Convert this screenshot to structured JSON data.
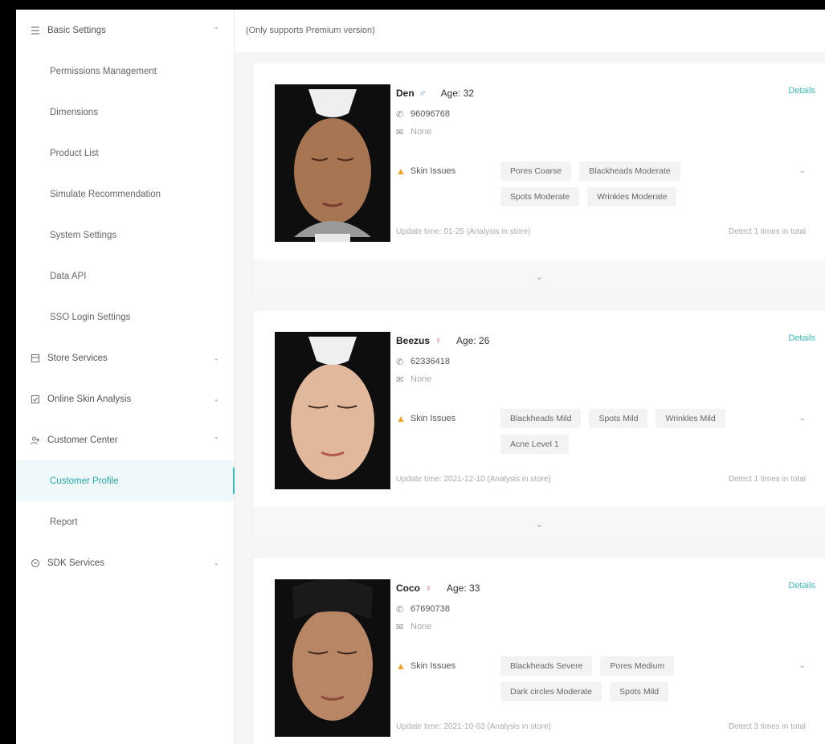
{
  "notice": "(Only supports Premium version)",
  "sidebar": {
    "items": [
      {
        "type": "group",
        "label": "Basic Settings",
        "icon": "list-icon",
        "caret": "⌃"
      },
      {
        "type": "sub",
        "label": "Permissions Management"
      },
      {
        "type": "sub",
        "label": "Dimensions"
      },
      {
        "type": "sub",
        "label": "Product List"
      },
      {
        "type": "sub",
        "label": "Simulate Recommendation"
      },
      {
        "type": "sub",
        "label": "System Settings"
      },
      {
        "type": "sub",
        "label": "Data API"
      },
      {
        "type": "sub",
        "label": "SSO Login Settings"
      },
      {
        "type": "group",
        "label": "Store Services",
        "icon": "store-icon",
        "caret": "⌄"
      },
      {
        "type": "group",
        "label": "Online Skin Analysis",
        "icon": "analysis-icon",
        "caret": "⌄"
      },
      {
        "type": "group",
        "label": "Customer Center",
        "icon": "customer-icon",
        "caret": "⌃"
      },
      {
        "type": "sub",
        "label": "Customer Profile",
        "active": true
      },
      {
        "type": "sub",
        "label": "Report"
      },
      {
        "type": "group",
        "label": "SDK Services",
        "icon": "sdk-icon",
        "caret": "⌄"
      }
    ]
  },
  "customers": [
    {
      "name": "Den",
      "gender": "male",
      "gender_symbol": "♂",
      "age": "Age: 32",
      "phone": "96096768",
      "email": "None",
      "skin_label": "Skin Issues",
      "tags": [
        "Pores Coarse",
        "Blackheads Moderate",
        "Spots Moderate",
        "Wrinkles Moderate"
      ],
      "update": "Update time: 01-25 (Analysis in store)",
      "detect": "Detect 1 times in total",
      "details": "Details"
    },
    {
      "name": "Beezus",
      "gender": "female",
      "gender_symbol": "♀",
      "age": "Age: 26",
      "phone": "62336418",
      "email": "None",
      "skin_label": "Skin Issues",
      "tags": [
        "Blackheads Mild",
        "Spots Mild",
        "Wrinkles Mild",
        "Acne Level 1"
      ],
      "update": "Update time: 2021-12-10 (Analysis in store)",
      "detect": "Detect 1 times in total",
      "details": "Details"
    },
    {
      "name": "Coco",
      "gender": "female",
      "gender_symbol": "♀",
      "age": "Age: 33",
      "phone": "67690738",
      "email": "None",
      "skin_label": "Skin Issues",
      "tags": [
        "Blackheads Severe",
        "Pores Medium",
        "Dark circles Moderate",
        "Spots Mild"
      ],
      "update": "Update time: 2021-10-03 (Analysis in store)",
      "detect": "Detect 3 times in total",
      "details": "Details"
    }
  ],
  "colors": {
    "accent": "#3bbcbc",
    "warning": "#f0a020",
    "male": "#4a7fdc",
    "female": "#e86a80"
  }
}
